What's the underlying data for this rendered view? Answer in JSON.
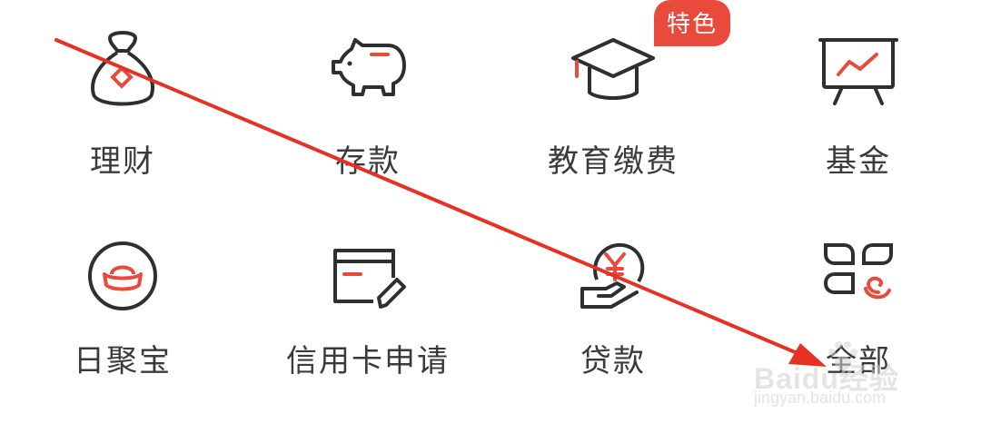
{
  "menu": {
    "row1": [
      {
        "label": "理财",
        "icon": "money-bag-icon"
      },
      {
        "label": "存款",
        "icon": "piggy-bank-icon"
      },
      {
        "label": "教育缴费",
        "icon": "graduation-cap-icon",
        "badge": "特色"
      },
      {
        "label": "基金",
        "icon": "chart-board-icon"
      }
    ],
    "row2": [
      {
        "label": "日聚宝",
        "icon": "gold-ingot-icon"
      },
      {
        "label": "信用卡申请",
        "icon": "credit-card-pen-icon"
      },
      {
        "label": "贷款",
        "icon": "yen-hand-icon"
      },
      {
        "label": "全部",
        "icon": "all-apps-icon"
      }
    ]
  },
  "colors": {
    "accent": "#e84b3c",
    "icon_stroke": "#2f2f2f",
    "label": "#3a3a3a",
    "annotation_arrow": "#e53224"
  },
  "watermark": {
    "brand": "Baidu经验",
    "url": "jingyan.baidu.com"
  }
}
